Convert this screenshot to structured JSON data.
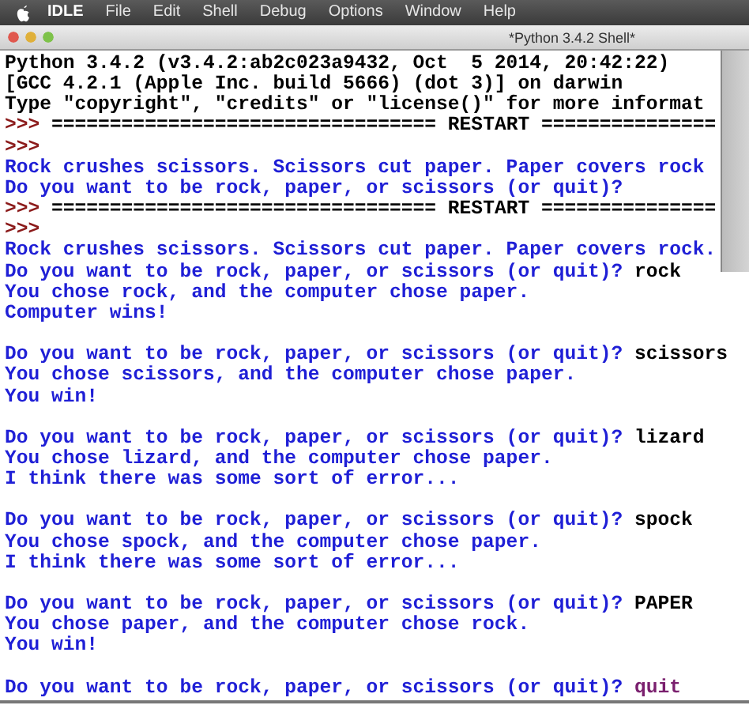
{
  "menu_bar": {
    "app": "IDLE",
    "items": [
      "File",
      "Edit",
      "Shell",
      "Debug",
      "Options",
      "Window",
      "Help"
    ]
  },
  "window": {
    "title": "*Python 3.4.2 Shell*"
  },
  "shell": {
    "lines": [
      {
        "kind": "text",
        "segments": [
          {
            "kind": "banner",
            "text": "Python 3.4.2 (v3.4.2:ab2c023a9432, Oct  5 2014, 20:42:22)"
          }
        ]
      },
      {
        "kind": "text",
        "segments": [
          {
            "kind": "banner",
            "text": "[GCC 4.2.1 (Apple Inc. build 5666) (dot 3)] on darwin"
          }
        ]
      },
      {
        "kind": "text",
        "segments": [
          {
            "kind": "banner",
            "text": "Type \"copyright\", \"credits\" or \"license()\" for more informat"
          }
        ]
      },
      {
        "kind": "text",
        "segments": [
          {
            "kind": "prompt",
            "text": ">>>"
          },
          {
            "kind": "banner",
            "text": "================================= RESTART ==============="
          }
        ]
      },
      {
        "kind": "text",
        "segments": [
          {
            "kind": "prompt",
            "text": ">>>"
          }
        ]
      },
      {
        "kind": "text",
        "segments": [
          {
            "kind": "output",
            "text": "Rock crushes scissors. Scissors cut paper. Paper covers rock"
          }
        ]
      },
      {
        "kind": "text",
        "segments": [
          {
            "kind": "output",
            "text": "Do you want to be rock, paper, or scissors (or quit)?"
          }
        ]
      },
      {
        "kind": "text",
        "segments": [
          {
            "kind": "prompt",
            "text": ">>>"
          },
          {
            "kind": "banner",
            "text": "================================= RESTART ==============="
          }
        ]
      },
      {
        "kind": "text",
        "segments": [
          {
            "kind": "prompt",
            "text": ">>>"
          }
        ]
      },
      {
        "kind": "text",
        "segments": [
          {
            "kind": "output",
            "text": "Rock crushes scissors. Scissors cut paper. Paper covers rock."
          }
        ]
      },
      {
        "kind": "text",
        "segments": [
          {
            "kind": "output",
            "text": "Do you want to be rock, paper, or scissors (or quit)?"
          },
          {
            "kind": "input",
            "text": "rock"
          }
        ]
      },
      {
        "kind": "text",
        "segments": [
          {
            "kind": "output",
            "text": "You chose rock, and the computer chose paper."
          }
        ]
      },
      {
        "kind": "text",
        "segments": [
          {
            "kind": "output",
            "text": "Computer wins!"
          }
        ]
      },
      {
        "kind": "blank"
      },
      {
        "kind": "text",
        "segments": [
          {
            "kind": "output",
            "text": "Do you want to be rock, paper, or scissors (or quit)?"
          },
          {
            "kind": "input",
            "text": "scissors"
          }
        ]
      },
      {
        "kind": "text",
        "segments": [
          {
            "kind": "output",
            "text": "You chose scissors, and the computer chose paper."
          }
        ]
      },
      {
        "kind": "text",
        "segments": [
          {
            "kind": "output",
            "text": "You win!"
          }
        ]
      },
      {
        "kind": "blank"
      },
      {
        "kind": "text",
        "segments": [
          {
            "kind": "output",
            "text": "Do you want to be rock, paper, or scissors (or quit)?"
          },
          {
            "kind": "input",
            "text": "lizard"
          }
        ]
      },
      {
        "kind": "text",
        "segments": [
          {
            "kind": "output",
            "text": "You chose lizard, and the computer chose paper."
          }
        ]
      },
      {
        "kind": "text",
        "segments": [
          {
            "kind": "output",
            "text": "I think there was some sort of error..."
          }
        ]
      },
      {
        "kind": "blank"
      },
      {
        "kind": "text",
        "segments": [
          {
            "kind": "output",
            "text": "Do you want to be rock, paper, or scissors (or quit)?"
          },
          {
            "kind": "input",
            "text": "spock"
          }
        ]
      },
      {
        "kind": "text",
        "segments": [
          {
            "kind": "output",
            "text": "You chose spock, and the computer chose paper."
          }
        ]
      },
      {
        "kind": "text",
        "segments": [
          {
            "kind": "output",
            "text": "I think there was some sort of error..."
          }
        ]
      },
      {
        "kind": "blank"
      },
      {
        "kind": "text",
        "segments": [
          {
            "kind": "output",
            "text": "Do you want to be rock, paper, or scissors (or quit)?"
          },
          {
            "kind": "input",
            "text": "PAPER"
          }
        ]
      },
      {
        "kind": "text",
        "segments": [
          {
            "kind": "output",
            "text": "You chose paper, and the computer chose rock."
          }
        ]
      },
      {
        "kind": "text",
        "segments": [
          {
            "kind": "output",
            "text": "You win!"
          }
        ]
      },
      {
        "kind": "blank"
      },
      {
        "kind": "text",
        "segments": [
          {
            "kind": "output",
            "text": "Do you want to be rock, paper, or scissors (or quit)?"
          },
          {
            "kind": "typing",
            "text": "quit"
          }
        ]
      }
    ]
  }
}
